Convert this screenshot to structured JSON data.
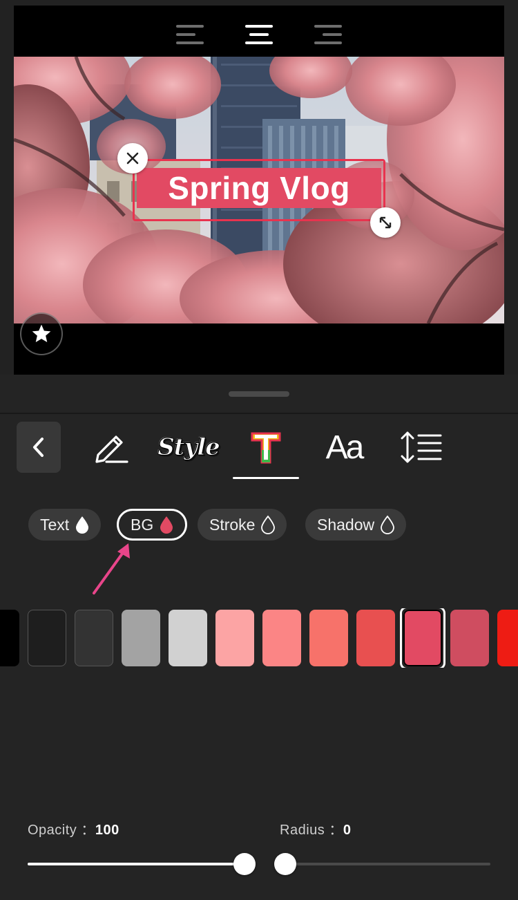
{
  "preview": {
    "title_text": "Spring Vlog",
    "text_bg_color": "#e24a63",
    "text_border_color": "#e8334e",
    "align_icons": [
      "align-left-icon",
      "align-center-icon",
      "align-right-icon"
    ],
    "active_align": "align-center-icon"
  },
  "toolbar": {
    "back_icon": "chevron-left-icon",
    "tools": [
      {
        "name": "edit-text",
        "icon": "pencil-icon"
      },
      {
        "name": "style",
        "label": "Style"
      },
      {
        "name": "text-color",
        "icon": "colored-t-icon",
        "active": true
      },
      {
        "name": "font",
        "label": "Aa"
      },
      {
        "name": "line-spacing",
        "icon": "line-spacing-icon"
      }
    ]
  },
  "color_targets": {
    "text": "Text",
    "bg": "BG",
    "stroke": "Stroke",
    "shadow": "Shadow",
    "selected": "BG"
  },
  "palette": {
    "colors": [
      "#000000",
      "#1e1e1e",
      "#333333",
      "#a3a3a3",
      "#d1d1d1",
      "#fca4a4",
      "#fb8585",
      "#f7726a",
      "#e85050",
      "#e24a63",
      "#cf4d60",
      "#ee1c14"
    ],
    "selected_index": 9
  },
  "opacity": {
    "label": "Opacity",
    "separator": "：",
    "value": "100",
    "level": 1.0
  },
  "radius": {
    "label": "Radius",
    "separator": "：",
    "value": "0",
    "level": 0.0
  }
}
